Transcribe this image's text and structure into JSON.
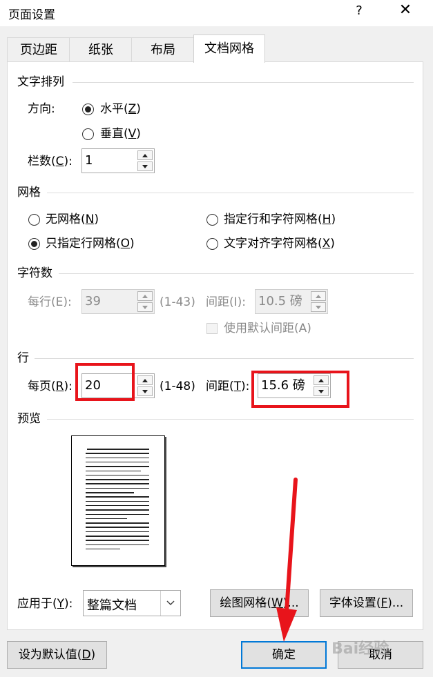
{
  "window": {
    "title": "页面设置",
    "help": "?",
    "close": "✕"
  },
  "tabs": [
    {
      "label": "页边距",
      "active": false
    },
    {
      "label": "纸张",
      "active": false
    },
    {
      "label": "布局",
      "active": false
    },
    {
      "label": "文档网格",
      "active": true
    }
  ],
  "text_direction": {
    "heading": "文字排列",
    "direction_label": "方向:",
    "horizontal": {
      "text": "水平(",
      "key": "Z",
      "end": ")",
      "selected": true
    },
    "vertical": {
      "text": "垂直(",
      "key": "V",
      "end": ")",
      "selected": false
    },
    "columns_label": {
      "text": "栏数(",
      "key": "C",
      "end": "):"
    },
    "columns_value": "1"
  },
  "grid": {
    "heading": "网格",
    "options": [
      {
        "text": "无网格(",
        "key": "N",
        "end": ")",
        "selected": false
      },
      {
        "text": "指定行和字符网格(",
        "key": "H",
        "end": ")",
        "selected": false
      },
      {
        "text": "只指定行网格(",
        "key": "O",
        "end": ")",
        "selected": true
      },
      {
        "text": "文字对齐字符网格(",
        "key": "X",
        "end": ")",
        "selected": false
      }
    ]
  },
  "characters": {
    "heading": "字符数",
    "per_line_label": "每行(E):",
    "per_line_value": "39",
    "per_line_range": "(1-43)",
    "pitch_label": "间距(I):",
    "pitch_value": "10.5 磅",
    "use_default_label": "使用默认间距(A)",
    "use_default_checked": false
  },
  "lines": {
    "heading": "行",
    "per_page_label": {
      "text": "每页(",
      "key": "R",
      "end": "):"
    },
    "per_page_value": "20",
    "per_page_range": "(1-48)",
    "pitch_label": {
      "text": "间距(",
      "key": "T",
      "end": "):"
    },
    "pitch_value": "15.6 磅"
  },
  "preview": {
    "heading": "预览"
  },
  "apply": {
    "label": {
      "text": "应用于(",
      "key": "Y",
      "end": "):"
    },
    "value": "整篇文档"
  },
  "buttons": {
    "draw_grid": {
      "text": "绘图网格(",
      "key": "W",
      "end": ")..."
    },
    "font_settings": {
      "text": "字体设置(",
      "key": "F",
      "end": ")..."
    },
    "set_default": {
      "text": "设为默认值(",
      "key": "D",
      "end": ")"
    },
    "ok": "确定",
    "cancel": "取消"
  },
  "watermark": "Bai经验",
  "colors": {
    "highlight": "#e8141b",
    "focus": "#0078d7"
  }
}
